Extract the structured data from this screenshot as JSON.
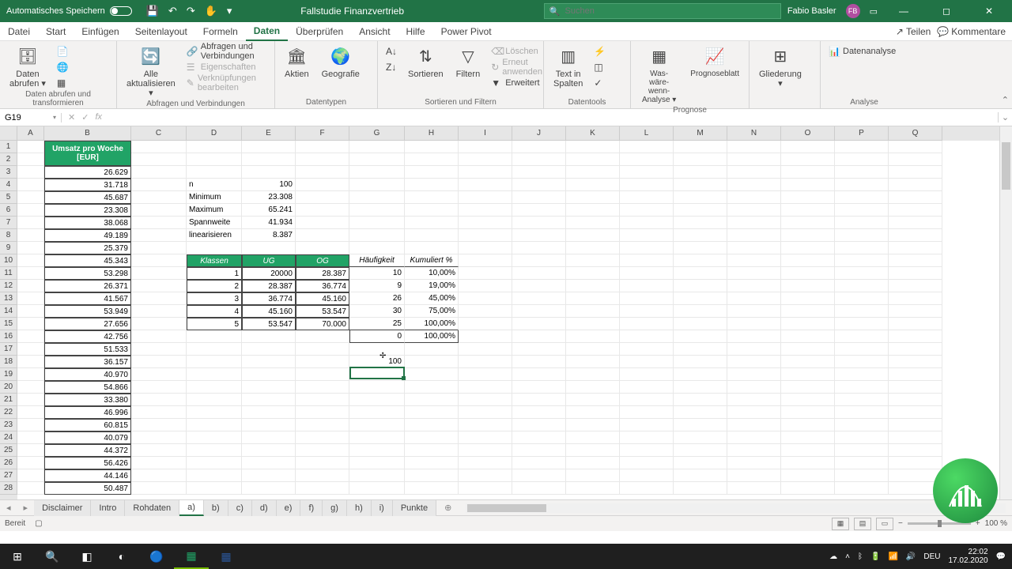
{
  "title": {
    "autosave_label": "Automatisches Speichern",
    "file": "Fallstudie Finanzvertrieb",
    "search_placeholder": "Suchen",
    "user": "Fabio Basler",
    "user_initials": "FB"
  },
  "menu": {
    "tabs": [
      "Datei",
      "Start",
      "Einfügen",
      "Seitenlayout",
      "Formeln",
      "Daten",
      "Überprüfen",
      "Ansicht",
      "Hilfe",
      "Power Pivot"
    ],
    "active": 5,
    "share": "Teilen",
    "comments": "Kommentare"
  },
  "ribbon": {
    "g0": {
      "btn0": "Daten\nabrufen ▾",
      "btn1": "Alle\naktualisieren ▾",
      "label0": "Daten abrufen und transformieren",
      "s0": "Abfragen und Verbindungen",
      "s1": "Eigenschaften",
      "s2": "Verknüpfungen bearbeiten",
      "label1": "Abfragen und Verbindungen"
    },
    "g1": {
      "b0": "Aktien",
      "b1": "Geografie",
      "label": "Datentypen"
    },
    "g2": {
      "sort": "Sortieren",
      "filter": "Filtern",
      "s0": "Löschen",
      "s1": "Erneut anwenden",
      "s2": "Erweitert",
      "label": "Sortieren und Filtern"
    },
    "g3": {
      "b0": "Text in\nSpalten",
      "label": "Datentools"
    },
    "g4": {
      "b0": "Was-wäre-wenn-\nAnalyse ▾",
      "b1": "Prognoseblatt",
      "label": "Prognose"
    },
    "g5": {
      "b0": "Gliederung\n▾",
      "b1": "Datenanalyse",
      "label": "Analyse"
    }
  },
  "fbar": {
    "name": "G19"
  },
  "cols": [
    "A",
    "B",
    "C",
    "D",
    "E",
    "F",
    "G",
    "H",
    "I",
    "J",
    "K",
    "L",
    "M",
    "N",
    "O",
    "P",
    "Q"
  ],
  "bheader": "Umsatz pro Woche [EUR]",
  "bdata": [
    "26.629",
    "31.718",
    "45.687",
    "23.308",
    "38.068",
    "49.189",
    "25.379",
    "45.343",
    "53.298",
    "26.371",
    "41.567",
    "53.949",
    "27.656",
    "42.756",
    "51.533",
    "36.157",
    "40.970",
    "54.866",
    "33.380",
    "46.996",
    "60.815",
    "40.079",
    "44.372",
    "56.426",
    "44.146",
    "50.487"
  ],
  "stats": {
    "n_l": "n",
    "n_v": "100",
    "min_l": "Minimum",
    "min_v": "23.308",
    "max_l": "Maximum",
    "max_v": "65.241",
    "sp_l": "Spannweite",
    "sp_v": "41.934",
    "lin_l": "linearisieren",
    "lin_v": "8.387"
  },
  "thdr": {
    "kl": "Klassen",
    "ug": "UG",
    "og": "OG",
    "hf": "Häufigkeit",
    "ku": "Kumuliert %"
  },
  "trows": [
    {
      "k": "1",
      "ug": "20000",
      "og": "28.387",
      "h": "10",
      "p": "10,00%"
    },
    {
      "k": "2",
      "ug": "28.387",
      "og": "36.774",
      "h": "9",
      "p": "19,00%"
    },
    {
      "k": "3",
      "ug": "36.774",
      "og": "45.160",
      "h": "26",
      "p": "45,00%"
    },
    {
      "k": "4",
      "ug": "45.160",
      "og": "53.547",
      "h": "30",
      "p": "75,00%"
    },
    {
      "k": "5",
      "ug": "53.547",
      "og": "70.000",
      "h": "25",
      "p": "100,00%"
    }
  ],
  "trow_extra": {
    "h": "0",
    "p": "100,00%"
  },
  "sum_val": "100",
  "sheets": [
    "Disclaimer",
    "Intro",
    "Rohdaten",
    "a)",
    "b)",
    "c)",
    "d)",
    "e)",
    "f)",
    "g)",
    "h)",
    "i)",
    "Punkte"
  ],
  "active_sheet": 3,
  "status": {
    "ready": "Bereit",
    "zoom": "100 %"
  },
  "clock": {
    "time": "22:02",
    "date": "17.02.2020"
  },
  "tray": {
    "lang": "DEU"
  }
}
